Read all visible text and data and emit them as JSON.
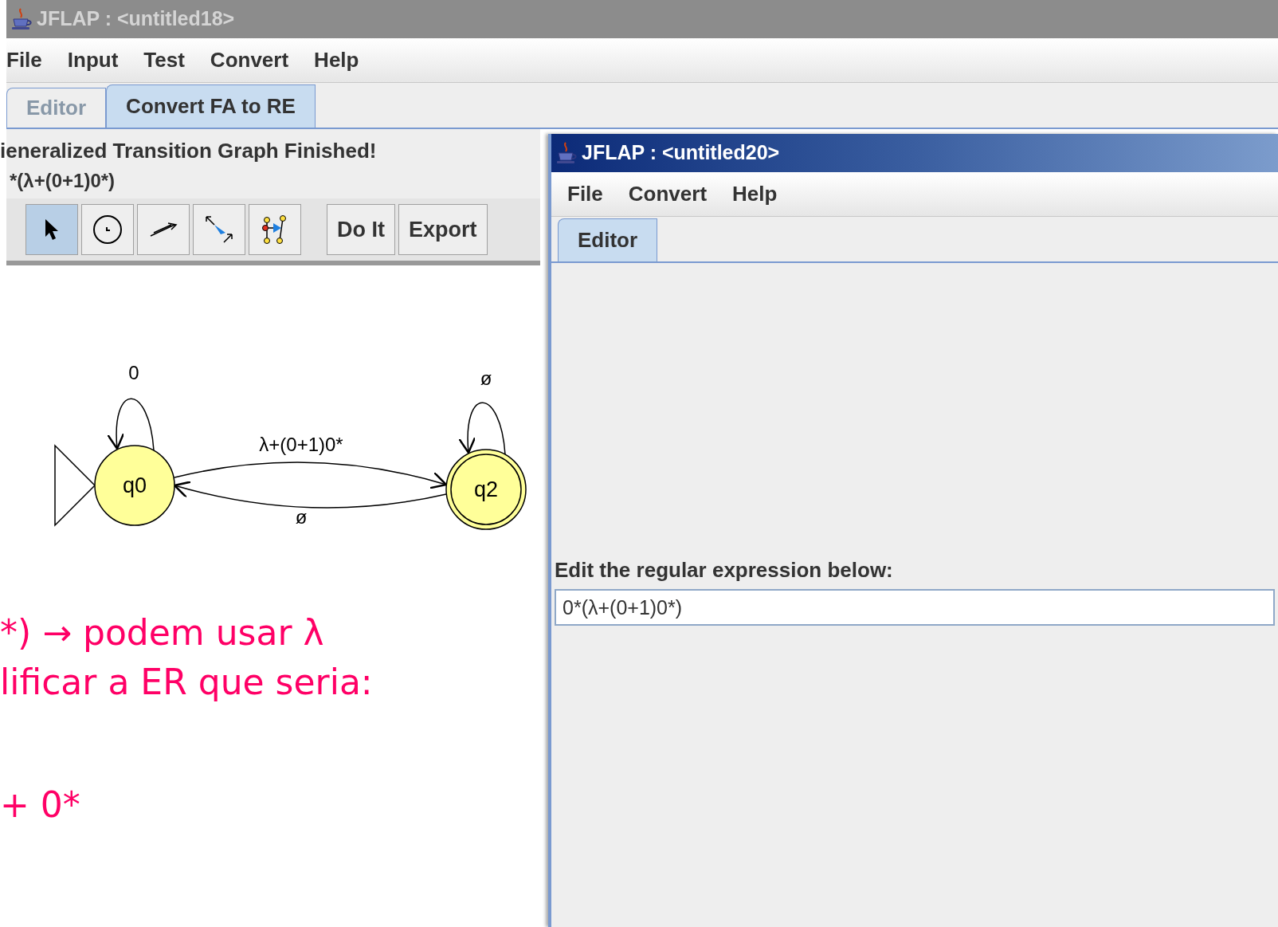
{
  "windows": [
    {
      "active": false,
      "title": "JFLAP : <untitled18>",
      "menu": [
        "File",
        "Input",
        "Test",
        "Convert",
        "Help"
      ],
      "tabs": [
        {
          "label": "Editor",
          "selected": false
        },
        {
          "label": "Convert FA to RE",
          "selected": true
        }
      ],
      "message": "ieneralized Transition Graph Finished!",
      "expression": "*(λ+(0+1)0*)",
      "tools": [
        {
          "kind": "select",
          "selected": true
        },
        {
          "kind": "state",
          "selected": false
        },
        {
          "kind": "transition",
          "selected": false
        },
        {
          "kind": "collapse",
          "selected": false
        },
        {
          "kind": "finalize",
          "selected": false
        }
      ],
      "buttons": [
        "Do It",
        "Export"
      ],
      "states": [
        {
          "label": "q0",
          "initial": true,
          "final": false
        },
        {
          "label": "q2",
          "initial": false,
          "final": true
        }
      ],
      "transitions": [
        {
          "kind": "loop",
          "label": "0"
        },
        {
          "kind": "loop",
          "label": "ø"
        },
        {
          "kind": "forward",
          "label": "λ+(0+1)0*"
        },
        {
          "kind": "back",
          "label": "ø"
        }
      ]
    },
    {
      "active": true,
      "title": "JFLAP : <untitled20>",
      "menu": [
        "File",
        "Convert",
        "Help"
      ],
      "tabs": [
        {
          "label": "Editor",
          "selected": true
        }
      ],
      "prompt": "Edit the regular expression below:",
      "field_value": "0*(λ+(0+1)0*)"
    }
  ],
  "slide_text": [
    "*) → podem usar λ",
    "lificar a ER que seria:",
    "+ 0*"
  ]
}
